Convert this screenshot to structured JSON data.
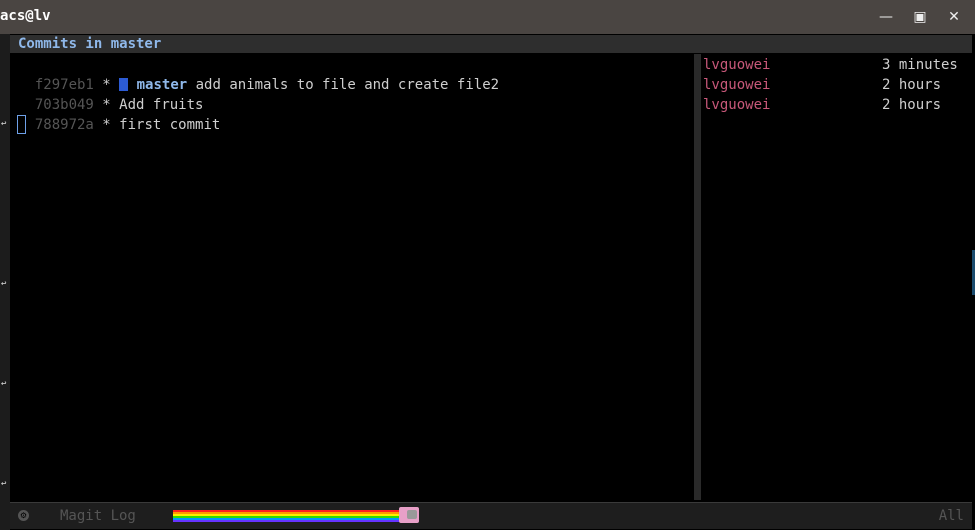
{
  "window": {
    "title": "acs@lv"
  },
  "header": {
    "title": "Commits in master"
  },
  "commits": [
    {
      "hash": "f297eb1",
      "graph": " * ",
      "branch": "master",
      "message": " add animals to file and create file2",
      "author": "lvguowei",
      "date": "3 minutes"
    },
    {
      "hash": "703b049",
      "graph": " * ",
      "message": "Add fruits",
      "author": "lvguowei",
      "date": "2 hours"
    },
    {
      "hash": "788972a",
      "graph": " * ",
      "message": "first commit",
      "author": "lvguowei",
      "date": "2 hours"
    }
  ],
  "modeline": {
    "mode": "Magit Log",
    "position": "All"
  },
  "colors": {
    "background": "#000000",
    "author": "#c8587a",
    "branch": "#8fb8ea",
    "titlebar": "#4a4542"
  },
  "icons": [
    "minimize-icon",
    "maximize-icon",
    "close-icon",
    "emacs-mode-icon",
    "nyan-cat-icon"
  ]
}
